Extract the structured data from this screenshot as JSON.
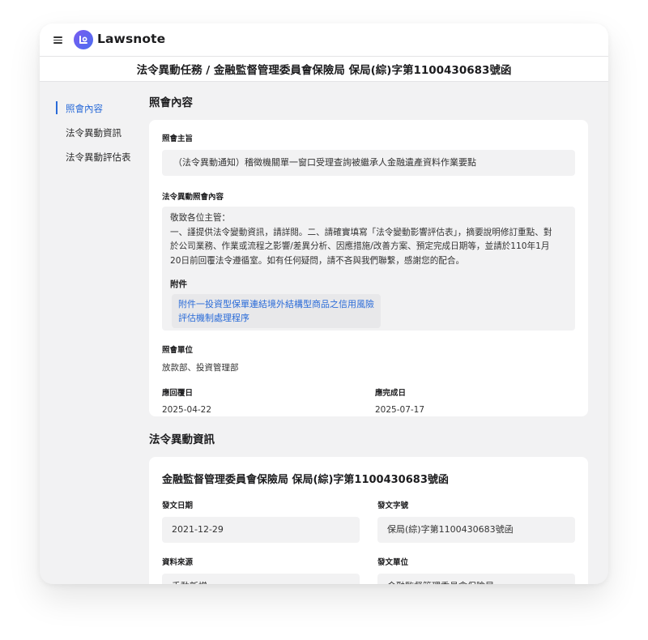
{
  "app": {
    "brand": "Lawsnote",
    "page_title": "法令異動任務 / 金融監督管理委員會保險局 保局(綜)字第1100430683號函"
  },
  "sidebar": {
    "items": [
      {
        "label": "照會內容",
        "active": true
      },
      {
        "label": "法令異動資訊",
        "active": false
      },
      {
        "label": "法令異動評估表",
        "active": false
      }
    ]
  },
  "notice": {
    "section_title": "照會內容",
    "subject_label": "照會主旨",
    "subject": "（法令異動通知）稽徵機關單一窗口受理查詢被繼承人金融遺產資料作業要點",
    "content_label": "法令異動照會內容",
    "content_lines": [
      "敬致各位主管：",
      "一、謹提供法令變動資訊，請詳閱。二、請確實填寫「法令變動影響評估表」，摘要說明修訂重點、對",
      "於公司業務、作業或流程之影響/差異分析、因應措施/改善方案、預定完成日期等，並請於110年1月",
      "20日前回覆法令遵循室。如有任何疑問，請不吝與我們聯繫，感謝您的配合。"
    ],
    "attachment_label": "附件",
    "attachment_lines": [
      "附件一投資型保單連結境外結構型商品之信用風險",
      "評估機制處理程序"
    ],
    "unit_label": "照會單位",
    "unit": "放款部、投資管理部",
    "reply_label": "應回覆日",
    "reply_date": "2025-04-22",
    "complete_label": "應完成日",
    "complete_date": "2025-07-17"
  },
  "regulation": {
    "section_title": "法令異動資訊",
    "doc_title": "金融監督管理委員會保險局 保局(綜)字第1100430683號函",
    "issue_date_label": "發文日期",
    "issue_date": "2021-12-29",
    "doc_number_label": "發文字號",
    "doc_number": "保局(綜)字第1100430683號函",
    "source_label": "資料來源",
    "source": "手動新增",
    "issuer_label": "發文單位",
    "issuer": "金融監督管理委員會保險局"
  },
  "colors": {
    "accent": "#2a6bd8",
    "logo_gradient_start": "#7a5cf0",
    "logo_gradient_end": "#4b6df0",
    "background": "#f2f2f3"
  },
  "icons": {
    "menu": "hamburger-menu-icon",
    "logo": "lawsnote-logo-icon"
  }
}
